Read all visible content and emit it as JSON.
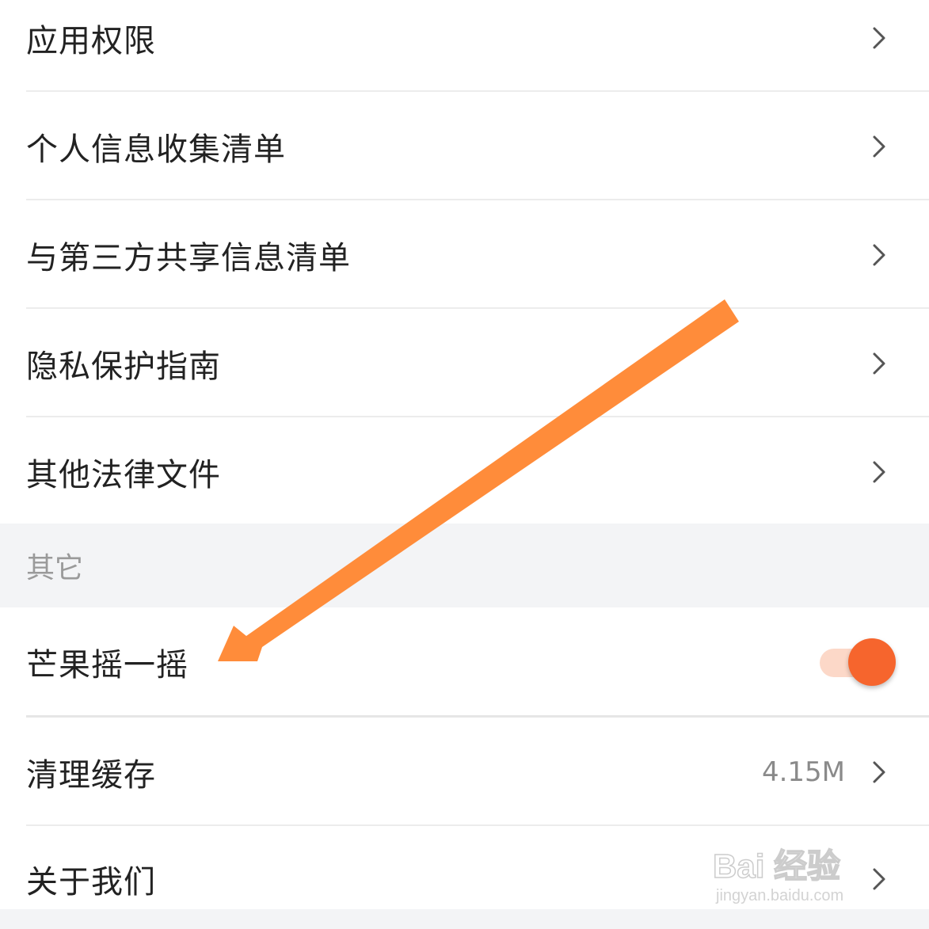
{
  "rows_top": [
    {
      "label": "应用权限"
    },
    {
      "label": "个人信息收集清单"
    },
    {
      "label": "与第三方共享信息清单"
    },
    {
      "label": "隐私保护指南"
    },
    {
      "label": "其他法律文件"
    }
  ],
  "section": {
    "title": "其它"
  },
  "shake": {
    "label": "芒果摇一摇",
    "toggle_on": true
  },
  "cache": {
    "label": "清理缓存",
    "value": "4.15M"
  },
  "about": {
    "label": "关于我们"
  },
  "watermark": {
    "main": "Bai 经验",
    "sub": "jingyan.baidu.com"
  },
  "colors": {
    "accent": "#f6652d",
    "toggle_track": "#fcd8c8",
    "arrow": "#ff8c3a",
    "section_bg": "#f3f4f6",
    "text": "#222222",
    "secondary_text": "#8a8a8a"
  },
  "icons": {
    "chevron": "chevron-right-icon",
    "arrow": "annotation-arrow"
  }
}
